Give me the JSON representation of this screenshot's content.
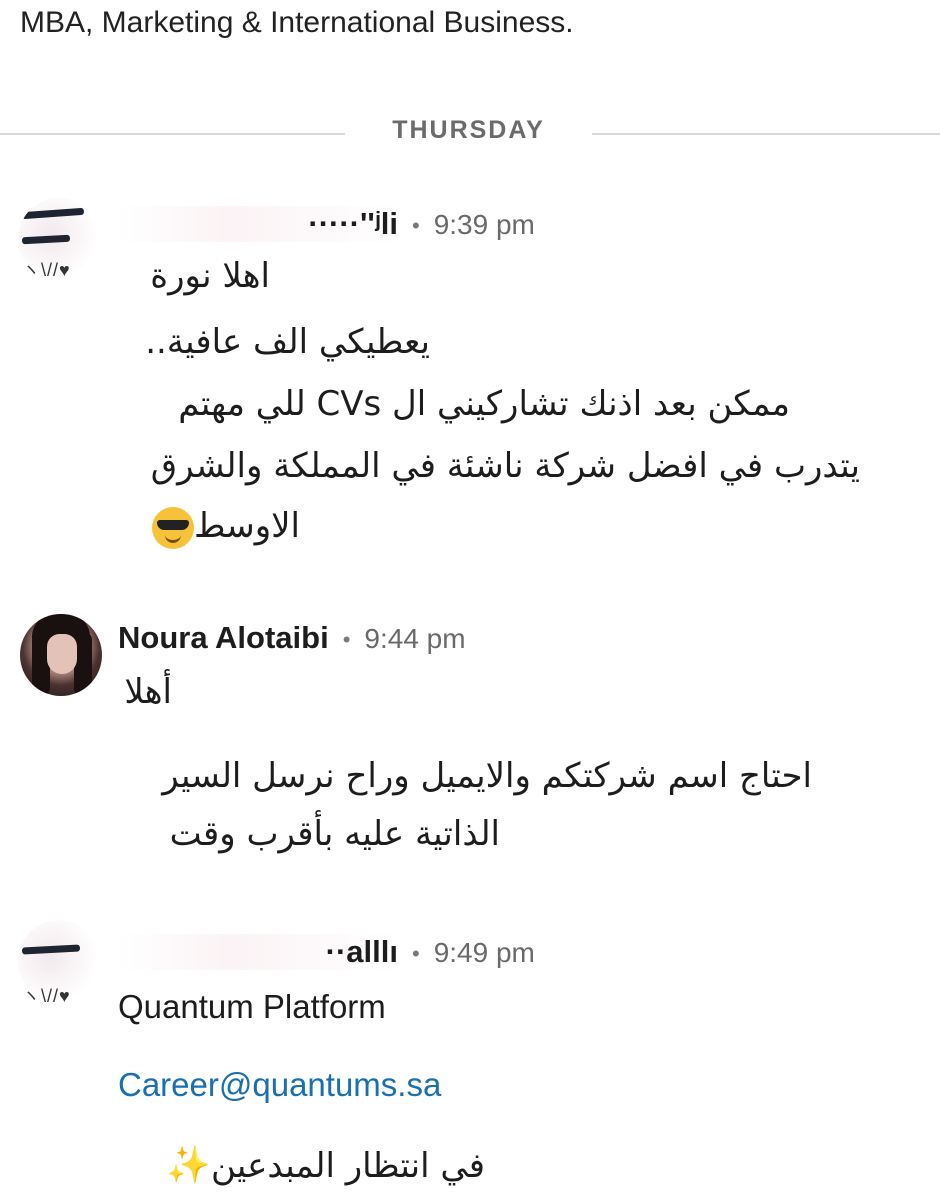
{
  "profile": {
    "headline": "MBA, Marketing & International Business."
  },
  "divider": {
    "day": "THURSDAY"
  },
  "messages": [
    {
      "sender": "·····''ʲli",
      "time": "9:39 pm",
      "avatar_marks": "ヽ\\//♥",
      "lines": [
        "اهلا نورة",
        "يعطيكي الف عافية..",
        "ممكن بعد اذنك تشاركيني ال CVs للي مهتم",
        "يتدرب في افضل شركة ناشئة في المملكة والشرق",
        "الاوسط"
      ],
      "emoji": "smiling-face-with-sunglasses"
    },
    {
      "sender": "Noura Alotaibi",
      "time": "9:44 pm",
      "lines": [
        "أهلا",
        "احتاج اسم شركتكم والايميل وراح نرسل السير",
        "الذاتية عليه بأقرب وقت"
      ]
    },
    {
      "sender": "··alllı",
      "time": "9:49 pm",
      "avatar_marks": "ヽ\\//♥",
      "company": "Quantum Platform",
      "email": "Career@quantums.sa",
      "closing": "في انتظار المبدعين",
      "closing_icon": "✨"
    }
  ],
  "separator": "•"
}
